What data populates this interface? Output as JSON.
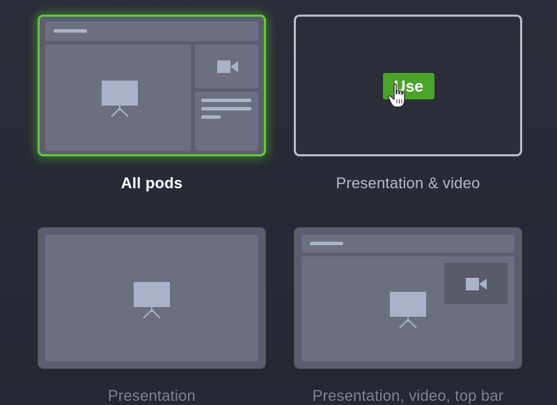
{
  "layouts": [
    {
      "id": "all-pods",
      "label": "All pods",
      "state": "selected"
    },
    {
      "id": "pres-video",
      "label": "Presentation & video",
      "state": "hover",
      "action_label": "Use"
    },
    {
      "id": "presentation",
      "label": "Presentation",
      "state": "default"
    },
    {
      "id": "pres-video-topbar",
      "label": "Presentation, video, top bar",
      "state": "default"
    }
  ],
  "icons": {
    "presentation": "presentation-screen-icon",
    "video": "video-camera-icon",
    "cursor": "hand-pointer-cursor-icon"
  },
  "colors": {
    "background": "#262932",
    "card_fill": "#5a5e6e",
    "panel_fill": "#6b6f80",
    "selected_border": "#5ecb3a",
    "hover_border": "#b9bdc9",
    "use_button": "#4aa32a",
    "label_active": "#ffffff",
    "label_muted": "#b4b9c7",
    "label_dim": "#7d8293"
  }
}
